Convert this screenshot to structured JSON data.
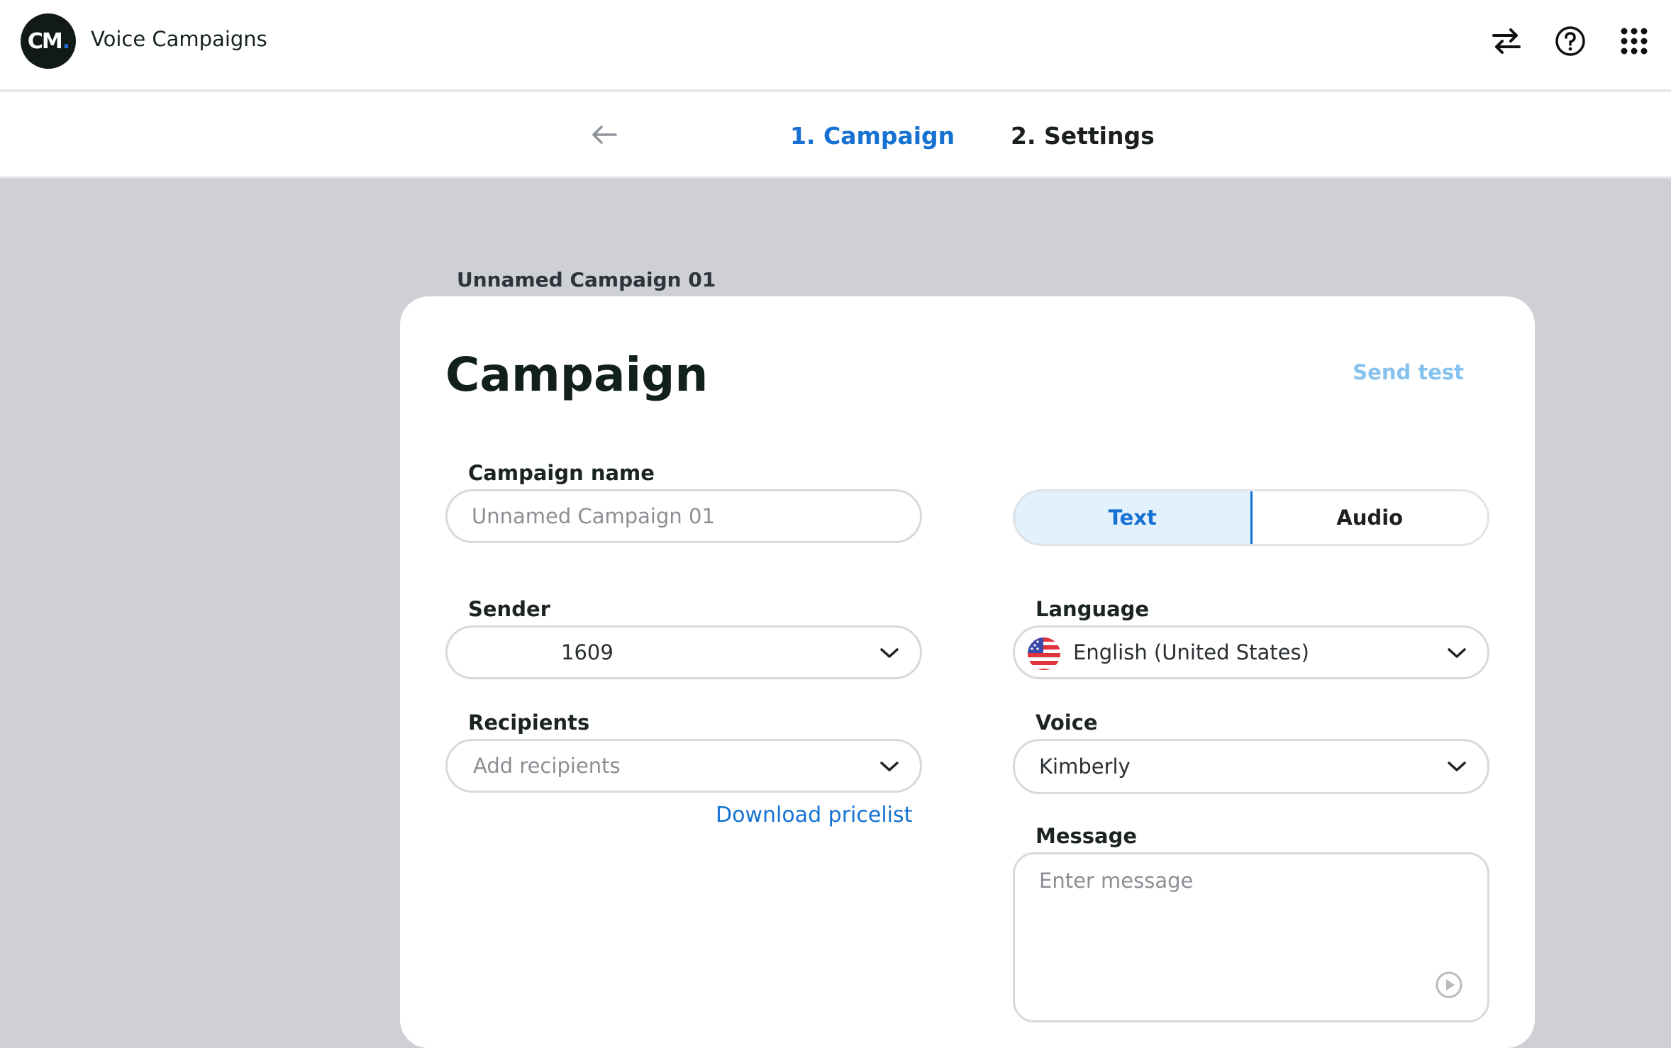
{
  "header": {
    "logo_text": "CM",
    "logo_dot": ".",
    "app_title": "Voice Campaigns",
    "icons": [
      "swap-arrows-icon",
      "help-circle-icon",
      "apps-grid-icon"
    ]
  },
  "steps": {
    "back_icon": "arrow-left-icon",
    "items": [
      {
        "label": "1. Campaign",
        "active": true
      },
      {
        "label": "2. Settings",
        "active": false
      }
    ]
  },
  "breadcrumb": "Unnamed Campaign 01",
  "card": {
    "title": "Campaign",
    "send_test": "Send test",
    "campaign_name": {
      "label": "Campaign name",
      "placeholder": "Unnamed Campaign 01"
    },
    "mode_toggle": {
      "options": [
        "Text",
        "Audio"
      ],
      "selected": "Text"
    },
    "sender": {
      "label": "Sender",
      "value": "1609"
    },
    "language": {
      "label": "Language",
      "value": "English (United States)",
      "flag": "us-flag-icon"
    },
    "recipients": {
      "label": "Recipients",
      "placeholder": "Add recipients"
    },
    "voice": {
      "label": "Voice",
      "value": "Kimberly"
    },
    "download_link": "Download pricelist",
    "message": {
      "label": "Message",
      "placeholder": "Enter message"
    }
  },
  "colors": {
    "accent": "#1672d2",
    "accent_light": "#e3f1fd",
    "send_test": "#86c2ef",
    "page_bg": "#cfd0d5"
  }
}
